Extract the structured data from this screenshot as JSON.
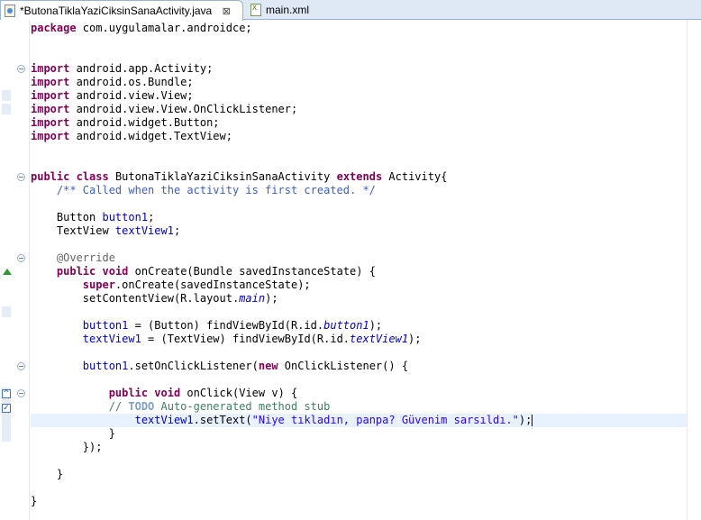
{
  "tabs": [
    {
      "label": "*ButonaTiklaYaziCiksinSanaActivity.java",
      "icon": "java-file-icon",
      "active": true,
      "close": "⊠"
    },
    {
      "label": "main.xml",
      "icon": "xml-file-icon",
      "active": false
    }
  ],
  "code": {
    "package_kw": "package",
    "package_name": " com.uygulamalar.androidce;",
    "import_kw": "import",
    "imports": [
      " android.app.Activity;",
      " android.os.Bundle;",
      " android.view.View;",
      " android.view.View.OnClickListener;",
      " android.widget.Button;",
      " android.widget.TextView;"
    ],
    "public": "public",
    "class": "class",
    "class_name": " ButonaTiklaYaziCiksinSanaActivity ",
    "extends": "extends",
    "extends_type": " Activity{",
    "javadoc": "    /** Called when the activity is first created. */",
    "button_decl_type": "    Button ",
    "button_decl_var": "button1",
    "semicolon": ";",
    "textview_decl_type": "    TextView ",
    "textview_decl_var": "textView1",
    "override": "    @Override",
    "void": "void",
    "oncreate_sig": " onCreate(Bundle savedInstanceState) {",
    "super": "super",
    "super_call": ".onCreate(savedInstanceState);",
    "setcontent_a": "        setContentView(R.layout.",
    "setcontent_main": "main",
    "setcontent_b": ");",
    "findb_var": "button1",
    "findb_mid": " = (Button) findViewById(R.id.",
    "findb_id": "button1",
    "findt_var": "textView1",
    "findt_mid": " = (TextView) findViewById(R.id.",
    "findt_id": "textView1",
    "close_paren": ");",
    "listener_var": "button1",
    "listener_mid": ".setOnClickListener(",
    "new": "new",
    "listener_end": " OnClickListener() {",
    "onclick_sig": " onClick(View v) {",
    "todo_prefix": "            // ",
    "todo_tag": "TODO",
    "todo_text": " Auto-generated method stub",
    "settext_var": "textView1",
    "settext_mid": ".setText(",
    "settext_str": "\"Niye tıkladın, panpa? Güvenim sarsıldı.\"",
    "settext_end": ");",
    "close_inner": "            }",
    "close_listener": "        });",
    "close_method": "    }",
    "close_class": "}"
  }
}
